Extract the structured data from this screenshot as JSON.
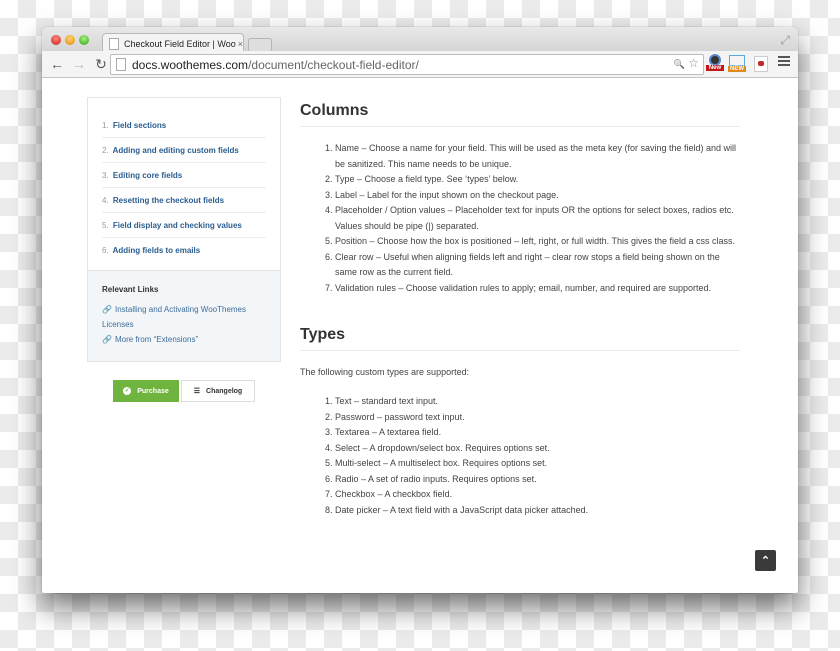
{
  "browser": {
    "tab_title": "Checkout Field Editor | WooThemes",
    "tab_close": "×",
    "url_host": "docs.woothemes.com",
    "url_path": "/document/checkout-field-editor/",
    "icons": {
      "back": "←",
      "forward": "→",
      "reload": "↻",
      "zoom": "🔍",
      "star": "☆",
      "fullscreen": "⤢"
    },
    "extensions": [
      {
        "name": "ext-speed",
        "badge": "New",
        "color": "#c31717"
      },
      {
        "name": "ext-screen",
        "badge": "NEW",
        "color": "#e08a1e"
      },
      {
        "name": "ext-pocket",
        "badge": "",
        "color": "#c52a2a"
      }
    ]
  },
  "sidebar": {
    "toc": [
      {
        "num": "1.",
        "label": "Field sections"
      },
      {
        "num": "2.",
        "label": "Adding and editing custom fields"
      },
      {
        "num": "3.",
        "label": "Editing core fields"
      },
      {
        "num": "4.",
        "label": "Resetting the checkout fields"
      },
      {
        "num": "5.",
        "label": "Field display and checking values"
      },
      {
        "num": "6.",
        "label": "Adding fields to emails"
      }
    ],
    "related": {
      "title": "Relevant Links",
      "links": [
        "Installing and Activating WooThemes Licenses",
        "More from “Extensions”"
      ]
    },
    "purchase_label": "Purchase",
    "changelog_label": "Changelog"
  },
  "main": {
    "columns": {
      "heading": "Columns",
      "items": [
        "Name – Choose a name for your field. This will be used as the meta key (for saving the field) and will be sanitized. This name needs to be unique.",
        "Type – Choose a field type. See ‘types’ below.",
        "Label – Label for the input shown on the checkout page.",
        "Placeholder / Option values – Placeholder text for inputs OR the options for select boxes, radios etc. Values should be pipe (|) separated.",
        "Position – Choose how the box is positioned – left, right, or full width. This gives the field a css class.",
        "Clear row – Useful when aligning fields left and right – clear row stops a field being shown on the same row as the current field.",
        "Validation rules – Choose validation rules to apply; email, number, and required are supported."
      ]
    },
    "types": {
      "heading": "Types",
      "intro": "The following custom types are supported:",
      "items": [
        "Text – standard text input.",
        "Password – password text input.",
        "Textarea – A textarea field.",
        "Select – A dropdown/select box. Requires options set.",
        "Multi-select – A multiselect box. Requires options set.",
        "Radio – A set of radio inputs. Requires options set.",
        "Checkbox – A checkbox field.",
        "Date picker – A text field with a JavaScript data picker attached."
      ]
    }
  },
  "scroll_top_icon": "⌃"
}
